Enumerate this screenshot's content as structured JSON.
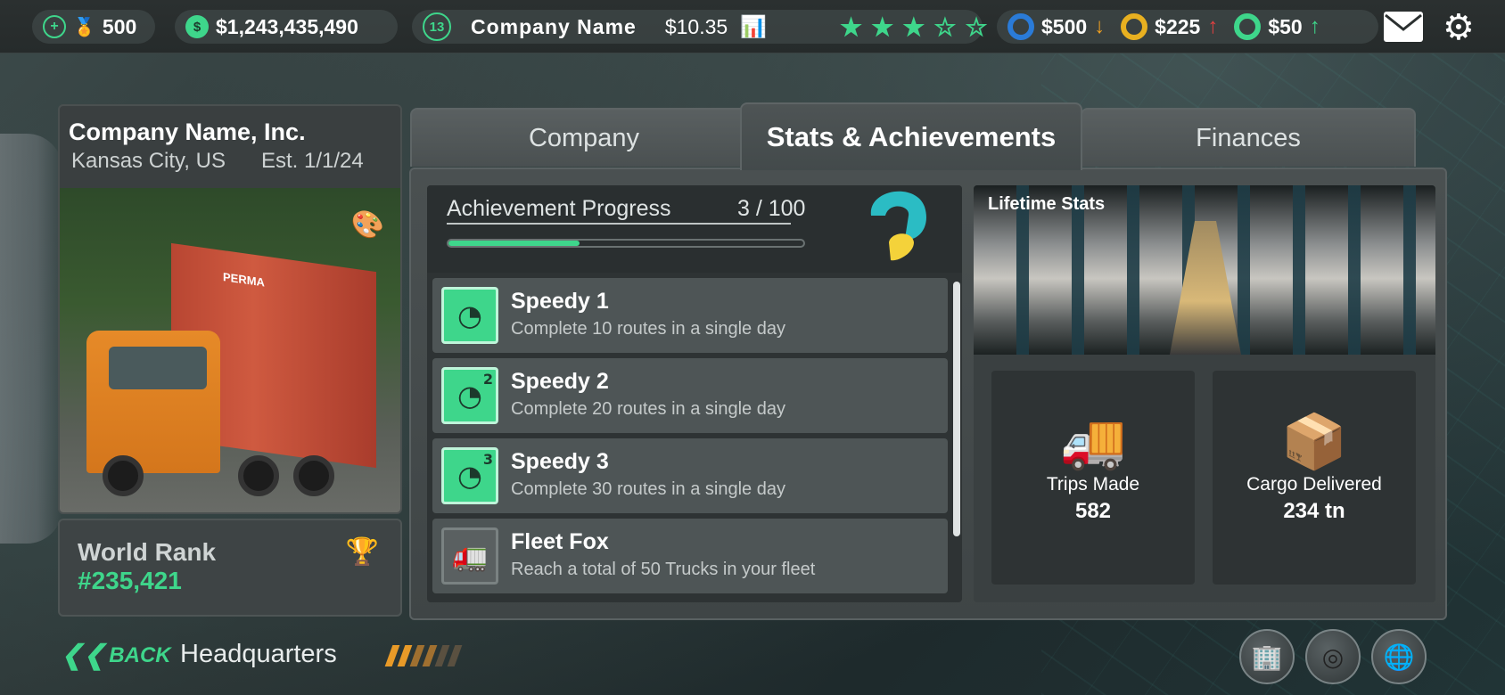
{
  "topbar": {
    "gold": "500",
    "cash": "$1,243,435,490",
    "level": "13",
    "company_name": "Company Name",
    "share_price": "$10.35",
    "rating_stars": 3,
    "rating_max": 5,
    "resources": [
      {
        "value": "$500",
        "trend": "down",
        "ring_color": "#2a7bd8"
      },
      {
        "value": "$225",
        "trend": "up",
        "ring_color": "#e8b020"
      },
      {
        "value": "$50",
        "trend": "up",
        "ring_color": "#3ed68b"
      }
    ],
    "icons": [
      "add-icon",
      "medal-icon",
      "money-bag-icon",
      "stock-chart-icon",
      "mail-icon",
      "gear-icon"
    ]
  },
  "profile": {
    "name": "Company Name, Inc.",
    "location": "Kansas City, US",
    "established": "Est. 1/1/24",
    "world_rank_label": "World Rank",
    "world_rank_value": "#235,421",
    "photo_truck_text": "PERMA"
  },
  "tabs": [
    {
      "label": "Company",
      "active": false
    },
    {
      "label": "Stats & Achievements",
      "active": true
    },
    {
      "label": "Finances",
      "active": false
    }
  ],
  "achievements": {
    "title": "Achievement Progress",
    "count": "3 / 100",
    "progress_fraction": 0.37,
    "items": [
      {
        "name": "Speedy 1",
        "desc": "Complete 10 routes in a single day",
        "unlocked": true,
        "badge": ""
      },
      {
        "name": "Speedy 2",
        "desc": "Complete 20 routes in a single day",
        "unlocked": true,
        "badge": "2"
      },
      {
        "name": "Speedy 3",
        "desc": "Complete 30 routes in a single day",
        "unlocked": true,
        "badge": "3"
      },
      {
        "name": "Fleet Fox",
        "desc": "Reach a total of  50 Trucks in your fleet",
        "unlocked": false,
        "badge": ""
      }
    ]
  },
  "lifetime": {
    "title": "Lifetime Stats",
    "stats": [
      {
        "label": "Trips Made",
        "value": "582",
        "icon": "truck-icon"
      },
      {
        "label": "Cargo Delivered",
        "value": "234 tn",
        "icon": "box-icon"
      }
    ]
  },
  "footer": {
    "back_label": "BACK",
    "location": "Headquarters",
    "buttons": [
      "building-icon",
      "tires-icon",
      "globe-icon"
    ]
  },
  "colors": {
    "accent": "#3ed68b",
    "brand_teal": "#2bbcc4",
    "brand_yellow": "#f4d23a"
  }
}
